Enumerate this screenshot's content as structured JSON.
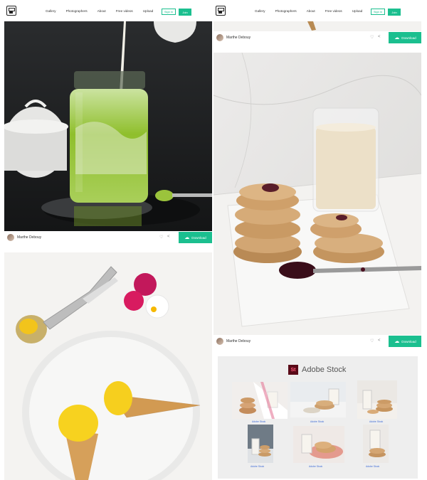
{
  "nav": {
    "links": [
      "Gallery",
      "Photographers",
      "About",
      "Free videos",
      "Upload"
    ],
    "sign_in": "Sign in",
    "join": "Join"
  },
  "photos": {
    "left_top": {
      "author": "Marthe Debouy",
      "download": "Download"
    },
    "right_top": {
      "author": "Marthe Debouy",
      "download": "Download"
    },
    "right_mid": {
      "author": "Marthe Debouy",
      "download": "Download"
    }
  },
  "adobe_stock": {
    "logo": "St",
    "title": "Adobe Stock",
    "captions": [
      "Adobe Stock",
      "Adobe Stock",
      "Adobe Stock",
      "Adobe Stock",
      "Adobe Stock",
      "Adobe Stock"
    ]
  },
  "colors": {
    "accent": "#1bbf8f",
    "adobe": "#5a0a18"
  }
}
